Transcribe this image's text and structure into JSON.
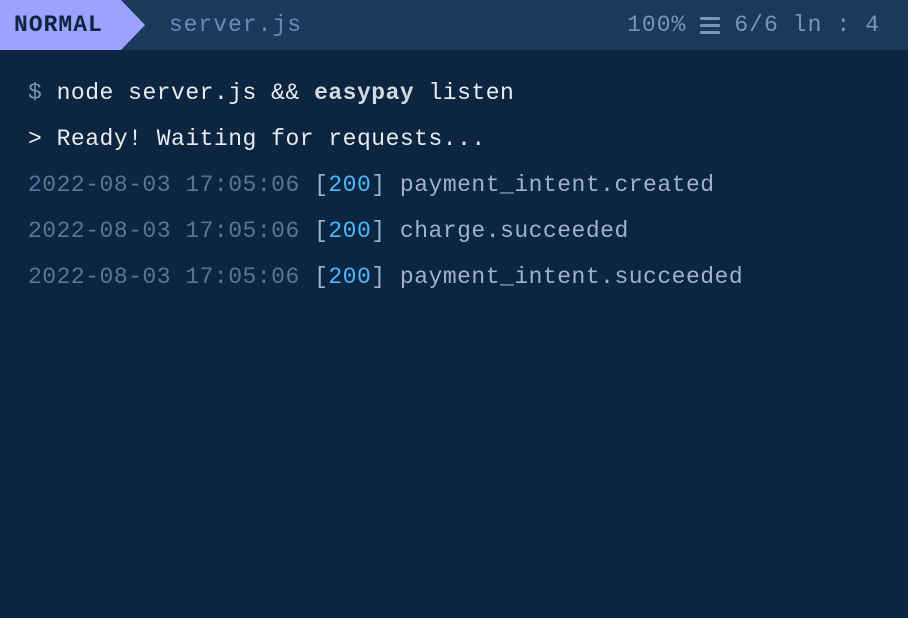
{
  "statusBar": {
    "mode": "NORMAL",
    "filename": "server.js",
    "percent": "100%",
    "lineInfo": "6/6",
    "lineLabel": "ln",
    "colon": ":",
    "column": "4"
  },
  "command": {
    "prompt": "$",
    "part1": "node server.js && ",
    "brand": "easypay",
    "part2": " listen"
  },
  "readyLine": {
    "prefix": ">",
    "text": "Ready! Waiting for requests..."
  },
  "logs": [
    {
      "timestamp": "2022-08-03 17:05:06",
      "status": "200",
      "event": "payment_intent.created"
    },
    {
      "timestamp": "2022-08-03 17:05:06",
      "status": "200",
      "event": "charge.succeeded"
    },
    {
      "timestamp": "2022-08-03 17:05:06",
      "status": "200",
      "event": "payment_intent.succeeded"
    }
  ]
}
